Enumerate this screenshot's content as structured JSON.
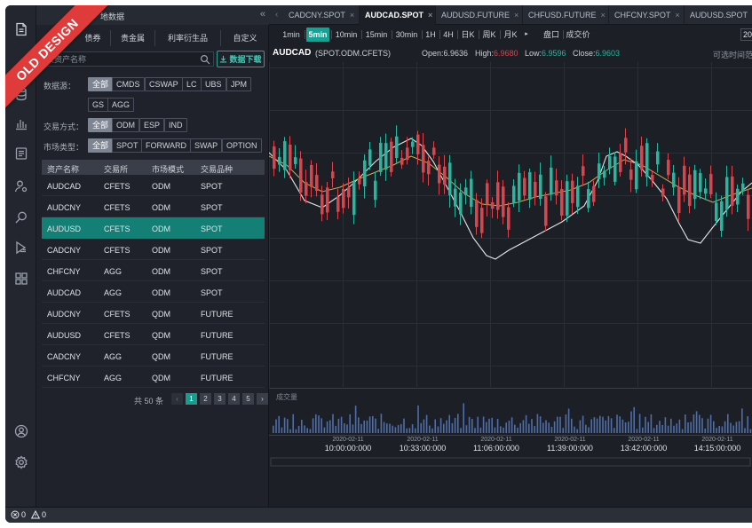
{
  "ribbon": {
    "text": "OLD DESIGN"
  },
  "left_panel": {
    "title": "地数据",
    "collapse_glyph": "«",
    "category_tabs": [
      "债券",
      "贵金属",
      "利率衍生品",
      "自定义"
    ],
    "search": {
      "placeholder": "录资产名称",
      "value": ""
    },
    "download_label": "数据下载",
    "filters": {
      "source": {
        "label": "数据源：",
        "options": [
          "全部",
          "CMDS",
          "CSWAP",
          "LC",
          "UBS",
          "JPM",
          "GS",
          "AGG"
        ],
        "active": 0
      },
      "trade_mode": {
        "label": "交易方式：",
        "options": [
          "全部",
          "ODM",
          "ESP",
          "IND"
        ],
        "active": 0
      },
      "market_type": {
        "label": "市场类型：",
        "options": [
          "全部",
          "SPOT",
          "FORWARD",
          "SWAP",
          "OPTION"
        ],
        "active": 0
      }
    },
    "table": {
      "columns": [
        "资产名称",
        "交易所",
        "市场模式",
        "交易品种"
      ],
      "rows": [
        [
          "AUDCAD",
          "CFETS",
          "ODM",
          "SPOT"
        ],
        [
          "AUDCNY",
          "CFETS",
          "ODM",
          "SPOT"
        ],
        [
          "AUDUSD",
          "CFETS",
          "ODM",
          "SPOT"
        ],
        [
          "CADCNY",
          "CFETS",
          "ODM",
          "SPOT"
        ],
        [
          "CHFCNY",
          "AGG",
          "ODM",
          "SPOT"
        ],
        [
          "AUDCAD",
          "AGG",
          "ODM",
          "SPOT"
        ],
        [
          "AUDCNY",
          "CFETS",
          "QDM",
          "FUTURE"
        ],
        [
          "AUDUSD",
          "CFETS",
          "QDM",
          "FUTURE"
        ],
        [
          "CADCNY",
          "AGG",
          "QDM",
          "FUTURE"
        ],
        [
          "CHFCNY",
          "AGG",
          "QDM",
          "FUTURE"
        ]
      ],
      "selected_row": 2
    },
    "pager": {
      "total": "共 50 条",
      "prev": "‹",
      "next": "›",
      "pages": [
        "1",
        "2",
        "3",
        "4",
        "5"
      ],
      "current": 0
    }
  },
  "tabs": {
    "items": [
      "CADCNY.SPOT",
      "AUDCAD.SPOT",
      "AUDUSD.FUTURE",
      "CHFUSD.FUTURE",
      "CHFCNY.SPOT",
      "AUDUSD.SPOT"
    ],
    "active": 1,
    "close_glyph": "×",
    "left_arrow": "‹"
  },
  "toolbar": {
    "intervals": [
      "1min",
      "5min",
      "10min",
      "15min",
      "30min",
      "1H",
      "4H",
      "日K",
      "周K",
      "月K"
    ],
    "active_interval": 1,
    "more_glyph": "▸",
    "actions": [
      "盘口",
      "成交价"
    ],
    "input_value": "20"
  },
  "info": {
    "symbol": "AUDCAD",
    "symbol_sub": "(SPOT.ODM.CFETS)",
    "open_label": "Open:",
    "open": "6.9636",
    "high_label": "High:",
    "high": "6.9680",
    "low_label": "Low:",
    "low": "6.9596",
    "close_label": "Close:",
    "close": "6.9603",
    "right_note": "可选时间范"
  },
  "volume_label": "成交量",
  "time_axis": [
    {
      "date": "2020-02-11",
      "time": "10:00:00:000"
    },
    {
      "date": "2020-02-11",
      "time": "10:33:00:000"
    },
    {
      "date": "2020-02-11",
      "time": "11:06:00:000"
    },
    {
      "date": "2020-02-11",
      "time": "11:39:00:000"
    },
    {
      "date": "2020-02-11",
      "time": "13:42:00:000"
    },
    {
      "date": "2020-02-11",
      "time": "14:15:00:000"
    }
  ],
  "status": {
    "errors": "0",
    "warnings": "0"
  },
  "colors": {
    "up": "#25b79f",
    "down": "#e0424a",
    "accent": "#18a092",
    "ma_white": "#e6e6e6",
    "ma_yellow": "#c9b15a"
  },
  "icons": {
    "activity": [
      "document-icon",
      "database-icon",
      "bar-chart-icon",
      "list-icon",
      "user-settings-icon",
      "search-icon",
      "deploy-icon",
      "grid-icon",
      "account-icon",
      "settings-icon"
    ]
  }
}
